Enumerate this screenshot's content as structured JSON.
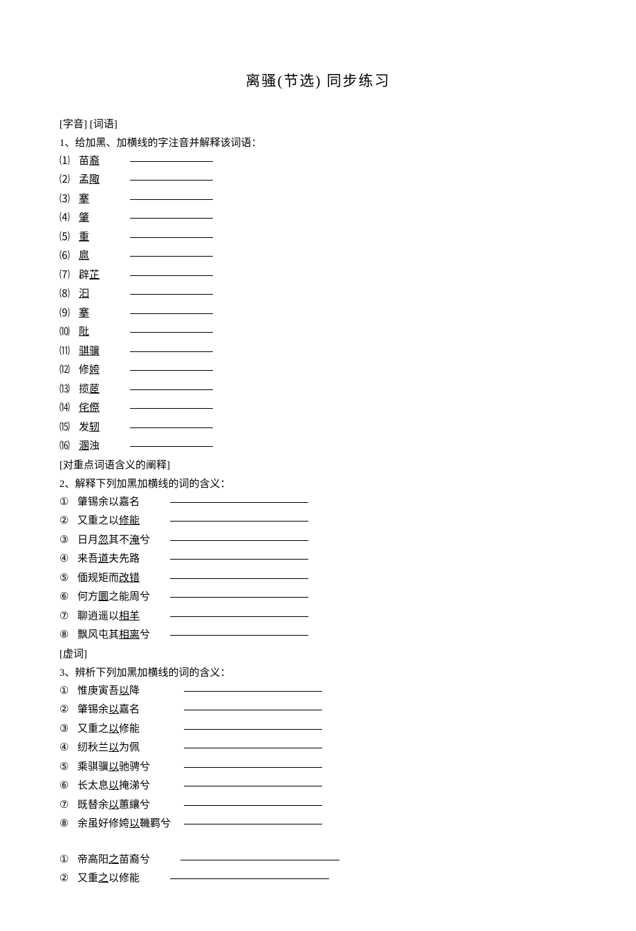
{
  "title": "离骚(节选)  同步练习",
  "section1_label": "[字音] [词语]",
  "q1_intro": "1、给加黑、加横线的字注音并解释该词语：",
  "q1_items": [
    {
      "num": "⑴",
      "pre": "苗",
      "u": "裔",
      "post": ""
    },
    {
      "num": "⑵",
      "pre": "孟",
      "u": "陬",
      "post": ""
    },
    {
      "num": "⑶",
      "pre": "",
      "u": "搴",
      "post": ""
    },
    {
      "num": "⑷",
      "pre": "",
      "u": "肇",
      "post": ""
    },
    {
      "num": "⑸",
      "pre": "",
      "u": "重",
      "post": ""
    },
    {
      "num": "⑹",
      "pre": "",
      "u": "扈",
      "post": ""
    },
    {
      "num": "⑺",
      "pre": "辟",
      "u": "芷",
      "post": ""
    },
    {
      "num": "⑻",
      "pre": "",
      "u": "汩",
      "post": ""
    },
    {
      "num": "⑼",
      "pre": "",
      "u": "搴",
      "post": ""
    },
    {
      "num": "⑽",
      "pre": "",
      "u": "阰",
      "post": ""
    },
    {
      "num": "⑾",
      "pre": "",
      "u": "骐骥",
      "post": ""
    },
    {
      "num": "⑿",
      "pre": "修",
      "u": "姱",
      "post": ""
    },
    {
      "num": "⒀",
      "pre": "揽",
      "u": "茝",
      "post": ""
    },
    {
      "num": "⒁",
      "pre": "",
      "u": "侘傺",
      "post": ""
    },
    {
      "num": "⒂",
      "pre": "发",
      "u": "轫",
      "post": ""
    },
    {
      "num": "⒃",
      "pre": "",
      "u": "溷",
      "post": "浊"
    }
  ],
  "section2_label": "  [对重点词语含义的阐释]",
  "q2_intro": "2、解释下列加黑加横线的词的含义：",
  "q2_items": [
    {
      "num": "①",
      "text": "肇锡余以嘉名",
      "u": ""
    },
    {
      "num": "②",
      "text": "又重之以",
      "u": "修能"
    },
    {
      "num": "③",
      "text_parts": [
        "日月",
        "其不",
        "兮"
      ],
      "u_parts": [
        "忽",
        "淹"
      ]
    },
    {
      "num": "④",
      "text": "来吾",
      "u": "道",
      "post": "夫先路"
    },
    {
      "num": "⑤",
      "text": "偭规矩而",
      "u": "改错"
    },
    {
      "num": "⑥",
      "text": "何方",
      "u": "圜",
      "post": "之能周兮"
    },
    {
      "num": "⑦",
      "text": "聊逍遥以",
      "u": "相羊"
    },
    {
      "num": "⑧",
      "text": "飘风屯其",
      "u": "相离",
      "post": "兮"
    }
  ],
  "section3_label": "[虚词]",
  "q3_intro": "3、辨析下列加黑加横线的词的含义：",
  "q3_items": [
    {
      "num": "①",
      "text": "惟庚寅吾",
      "u": "以",
      "post": "降"
    },
    {
      "num": "②",
      "text": "肇锡余",
      "u": "以",
      "post": "嘉名"
    },
    {
      "num": "③",
      "text": "又重之",
      "u": "以",
      "post": "修能"
    },
    {
      "num": "④",
      "text": "纫秋兰",
      "u": "以",
      "post": "为佩"
    },
    {
      "num": "⑤",
      "text": "乘骐骥",
      "u": "以",
      "post": "驰骋兮"
    },
    {
      "num": "⑥",
      "text": "长太息",
      "u": "以",
      "post": "掩涕兮"
    },
    {
      "num": "⑦",
      "text": "既替余",
      "u": "以",
      "post": "蕙纕兮"
    },
    {
      "num": "⑧",
      "text": "余虽好修姱",
      "u": "以",
      "post": "鞿羁兮"
    }
  ],
  "q4_items": [
    {
      "num": "①",
      "text": "帝高阳",
      "u": "之",
      "post": "苗裔兮"
    },
    {
      "num": "②",
      "text": "又重",
      "u": "之",
      "post": "以修能"
    }
  ]
}
